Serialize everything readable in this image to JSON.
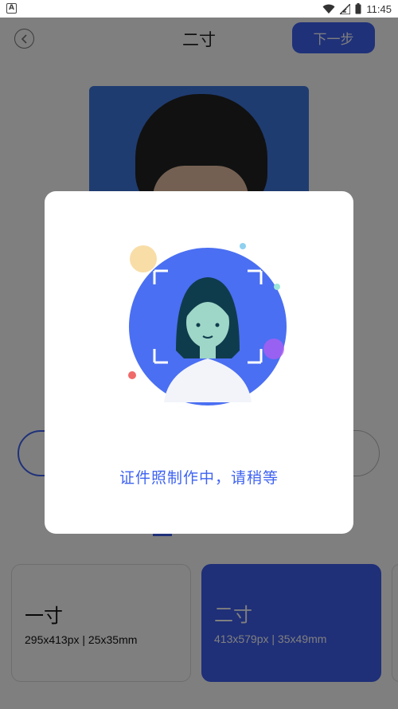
{
  "status_bar": {
    "time": "11:45"
  },
  "header": {
    "title": "二寸",
    "next_label": "下一步"
  },
  "size_cards": [
    {
      "title": "一寸",
      "spec": "295x413px | 25x35mm",
      "selected": false
    },
    {
      "title": "二寸",
      "spec": "413x579px | 35x49mm",
      "selected": true
    }
  ],
  "dialog": {
    "message": "证件照制作中，请稍等"
  },
  "colors": {
    "accent": "#3f63f2",
    "overlay": "rgba(0,0,0,0.5)"
  }
}
